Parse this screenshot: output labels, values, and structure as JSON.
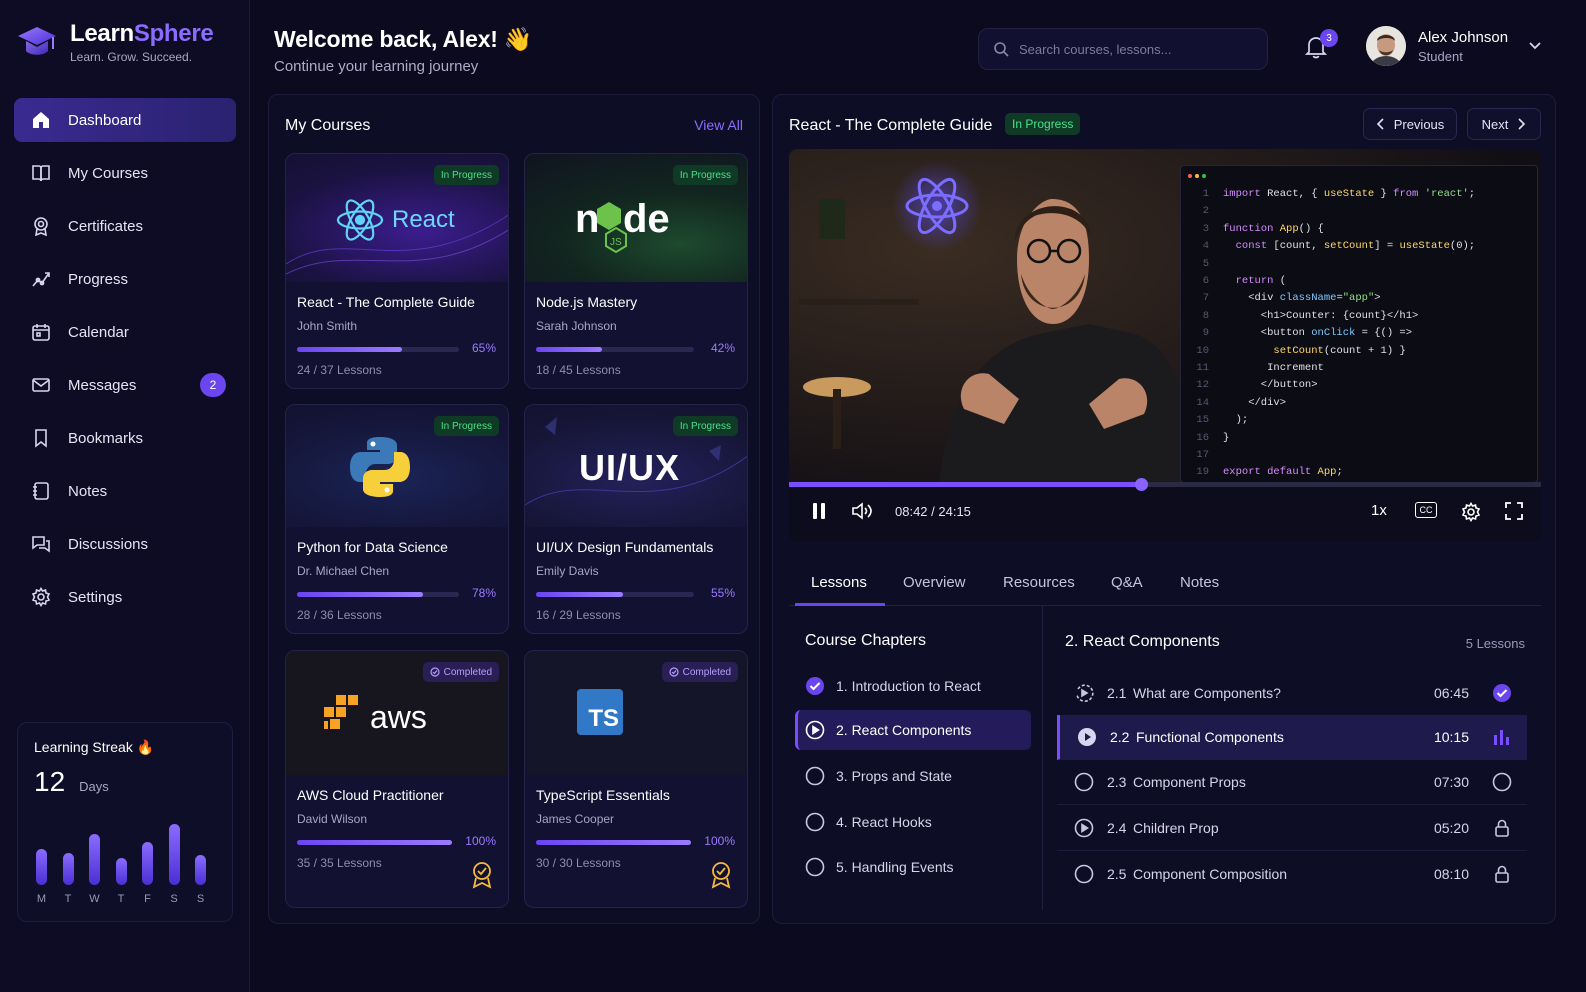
{
  "brand": {
    "name_a": "Learn",
    "name_b": "Sphere",
    "tagline": "Learn. Grow. Succeed."
  },
  "nav": [
    {
      "label": "Dashboard",
      "icon": "home-icon",
      "active": true
    },
    {
      "label": "My Courses",
      "icon": "book-icon"
    },
    {
      "label": "Certificates",
      "icon": "certificate-icon"
    },
    {
      "label": "Progress",
      "icon": "progress-icon"
    },
    {
      "label": "Calendar",
      "icon": "calendar-icon"
    },
    {
      "label": "Messages",
      "icon": "mail-icon",
      "badge": "2"
    },
    {
      "label": "Bookmarks",
      "icon": "bookmark-icon"
    },
    {
      "label": "Notes",
      "icon": "notes-icon"
    },
    {
      "label": "Discussions",
      "icon": "chat-icon"
    },
    {
      "label": "Settings",
      "icon": "gear-icon"
    }
  ],
  "streak": {
    "title": "Learning Streak 🔥",
    "value": "12",
    "unit": "Days",
    "days": [
      "M",
      "T",
      "W",
      "T",
      "F",
      "S",
      "S"
    ],
    "levels": [
      0.58,
      0.52,
      0.82,
      0.44,
      0.7,
      0.98,
      0.48
    ]
  },
  "header": {
    "welcome": "Welcome back, Alex! 👋",
    "subtitle": "Continue your learning journey",
    "search_placeholder": "Search courses, lessons...",
    "notif_count": "3",
    "user_name": "Alex Johnson",
    "user_role": "Student"
  },
  "courses": {
    "title": "My Courses",
    "view_all": "View All",
    "items": [
      {
        "title": "React - The Complete Guide",
        "author": "John Smith",
        "pct": "65%",
        "progress": 0.65,
        "lessons": "24 / 37 Lessons",
        "status": "In Progress",
        "logo": "React"
      },
      {
        "title": "Node.js Mastery",
        "author": "Sarah Johnson",
        "pct": "42%",
        "progress": 0.42,
        "lessons": "18 / 45 Lessons",
        "status": "In Progress",
        "logo": "node"
      },
      {
        "title": "Python for Data Science",
        "author": "Dr. Michael Chen",
        "pct": "78%",
        "progress": 0.78,
        "lessons": "28 / 36 Lessons",
        "status": "In Progress",
        "logo": ""
      },
      {
        "title": "UI/UX Design Fundamentals",
        "author": "Emily Davis",
        "pct": "55%",
        "progress": 0.55,
        "lessons": "16 / 29 Lessons",
        "status": "In Progress",
        "logo": "UI/UX"
      },
      {
        "title": "AWS Cloud Practitioner",
        "author": "David Wilson",
        "pct": "100%",
        "progress": 1,
        "lessons": "35 / 35 Lessons",
        "status": "Completed",
        "logo": "aws"
      },
      {
        "title": "TypeScript Essentials",
        "author": "James Cooper",
        "pct": "100%",
        "progress": 1,
        "lessons": "30 / 30 Lessons",
        "status": "Completed",
        "logo": "TS"
      }
    ]
  },
  "player": {
    "title": "React - The Complete Guide",
    "status": "In Progress",
    "prev": "Previous",
    "next": "Next",
    "time": "08:42 / 24:15",
    "speed": "1x",
    "cc": "CC",
    "progress": 0.47,
    "code": [
      [
        "1",
        "import React, { useState } from 'react';"
      ],
      [
        "2",
        ""
      ],
      [
        "3",
        "function App() {"
      ],
      [
        "4",
        "  const [count, setCount] = useState(0);"
      ],
      [
        "5",
        ""
      ],
      [
        "6",
        "  return ("
      ],
      [
        "7",
        "    <div className=\"app\">"
      ],
      [
        "8",
        "      <h1>Counter: {count}</h1>"
      ],
      [
        "9",
        "      <button onClick = {() =>"
      ],
      [
        "10",
        "        setCount(count + 1) }"
      ],
      [
        "11",
        "       Increment"
      ],
      [
        "12",
        "      </button>"
      ],
      [
        "14",
        "    </div>"
      ],
      [
        "15",
        "  );"
      ],
      [
        "16",
        "}"
      ],
      [
        "17",
        ""
      ],
      [
        "19",
        "export default App;"
      ]
    ]
  },
  "tabs": [
    "Lessons",
    "Overview",
    "Resources",
    "Q&A",
    "Notes"
  ],
  "chapters": {
    "title": "Course Chapters",
    "items": [
      {
        "label": "1. Introduction to React",
        "state": "done"
      },
      {
        "label": "2. React Components",
        "state": "active"
      },
      {
        "label": "3. Props and State",
        "state": "todo"
      },
      {
        "label": "4. React Hooks",
        "state": "todo"
      },
      {
        "label": "5. Handling Events",
        "state": "todo"
      }
    ]
  },
  "lessons": {
    "title": "2. React Components",
    "count": "5 Lessons",
    "items": [
      {
        "num": "2.1",
        "name": "What are Components?",
        "dur": "06:45",
        "status": "completed"
      },
      {
        "num": "2.2",
        "name": "Functional Components",
        "dur": "10:15",
        "status": "playing"
      },
      {
        "num": "2.3",
        "name": "Component Props",
        "dur": "07:30",
        "status": "open"
      },
      {
        "num": "2.4",
        "name": "Children Prop",
        "dur": "05:20",
        "status": "locked"
      },
      {
        "num": "2.5",
        "name": "Component Composition",
        "dur": "08:10",
        "status": "locked"
      }
    ]
  }
}
